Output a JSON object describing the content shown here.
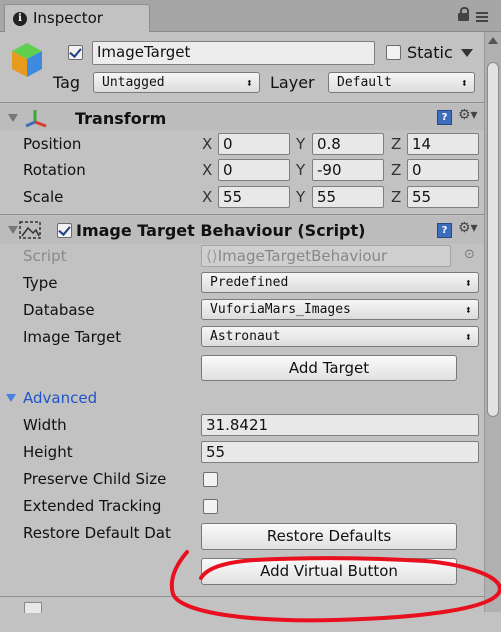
{
  "window": {
    "tab_label": "Inspector"
  },
  "object": {
    "name": "ImageTarget",
    "static_label": "Static",
    "tag_label": "Tag",
    "tag_value": "Untagged",
    "layer_label": "Layer",
    "layer_value": "Default"
  },
  "transform": {
    "title": "Transform",
    "axes": {
      "x": "X",
      "y": "Y",
      "z": "Z"
    },
    "rows": [
      {
        "label": "Position",
        "x": "0",
        "y": "0.8",
        "z": "14"
      },
      {
        "label": "Rotation",
        "x": "0",
        "y": "-90",
        "z": "0"
      },
      {
        "label": "Scale",
        "x": "55",
        "y": "55",
        "z": "55"
      }
    ]
  },
  "behaviour": {
    "title": "Image Target Behaviour (Script)",
    "script_label": "Script",
    "script_value": "ImageTargetBehaviour",
    "type_label": "Type",
    "type_value": "Predefined",
    "database_label": "Database",
    "database_value": "VuforiaMars_Images",
    "image_target_label": "Image Target",
    "image_target_value": "Astronaut",
    "add_target_button": "Add Target",
    "advanced_label": "Advanced",
    "width_label": "Width",
    "width_value": "31.8421",
    "height_label": "Height",
    "height_value": "55",
    "preserve_label": "Preserve Child Size",
    "extended_label": "Extended Tracking",
    "restore_label": "Restore Default Dat",
    "restore_button": "Restore Defaults",
    "virtual_button": "Add Virtual Button"
  },
  "icons": {
    "info": "info-icon",
    "lock": "lock-icon",
    "menu": "menu-icon",
    "cube": "cube-icon",
    "transform": "transform-axes-icon",
    "script": "script-icon",
    "help": "help-icon",
    "gear": "gear-icon"
  },
  "colors": {
    "accent_blue": "#3e6dbd",
    "advanced_blue": "#1f55c8",
    "annotation_red": "#e8101e",
    "panel": "#c2c2c2"
  }
}
